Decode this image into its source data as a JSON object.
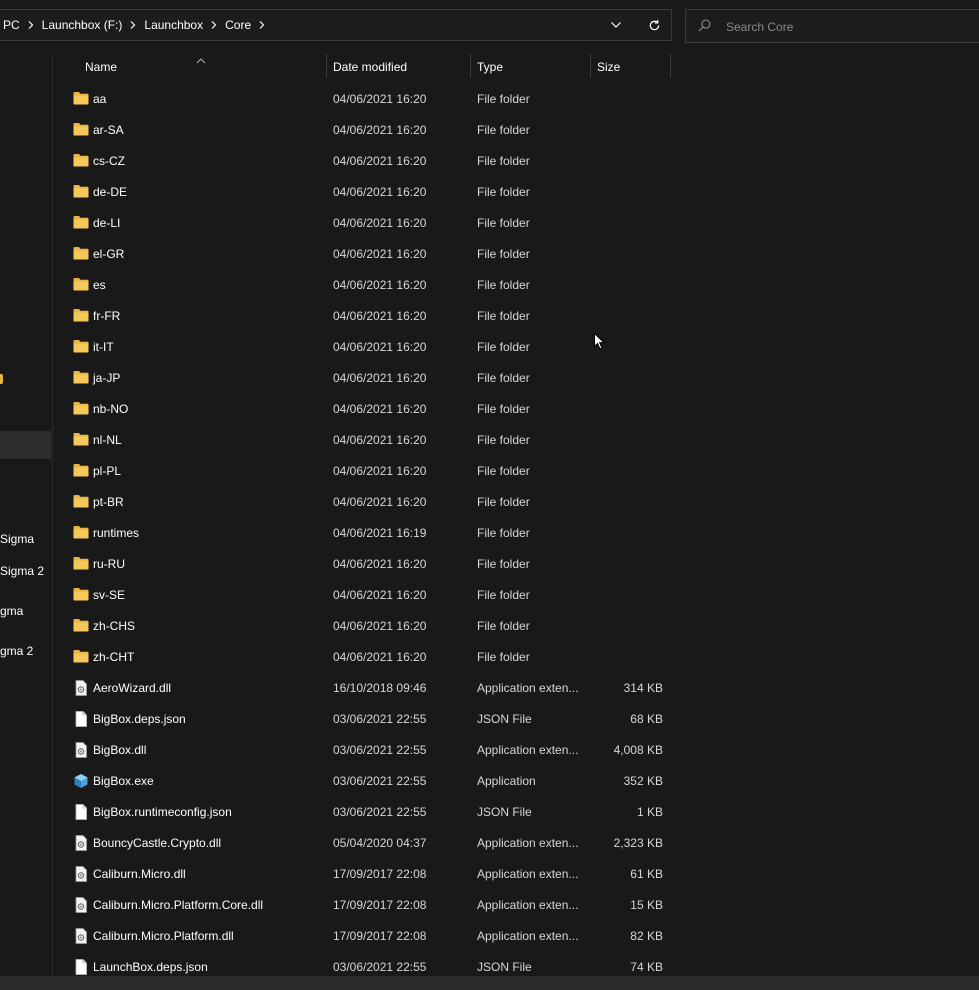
{
  "address": {
    "crumbs": [
      "PC",
      "Launchbox (F:)",
      "Launchbox",
      "Core"
    ]
  },
  "search": {
    "placeholder": "Search Core"
  },
  "nav": {
    "items": [
      "Sigma",
      "Sigma 2",
      "gma",
      "gma 2"
    ]
  },
  "columns": {
    "name": "Name",
    "date": "Date modified",
    "type": "Type",
    "size": "Size"
  },
  "files": [
    {
      "name": "aa",
      "date": "04/06/2021 16:20",
      "type": "File folder",
      "size": "",
      "icon": "folder-icon"
    },
    {
      "name": "ar-SA",
      "date": "04/06/2021 16:20",
      "type": "File folder",
      "size": "",
      "icon": "folder-icon"
    },
    {
      "name": "cs-CZ",
      "date": "04/06/2021 16:20",
      "type": "File folder",
      "size": "",
      "icon": "folder-icon"
    },
    {
      "name": "de-DE",
      "date": "04/06/2021 16:20",
      "type": "File folder",
      "size": "",
      "icon": "folder-icon"
    },
    {
      "name": "de-LI",
      "date": "04/06/2021 16:20",
      "type": "File folder",
      "size": "",
      "icon": "folder-icon"
    },
    {
      "name": "el-GR",
      "date": "04/06/2021 16:20",
      "type": "File folder",
      "size": "",
      "icon": "folder-icon"
    },
    {
      "name": "es",
      "date": "04/06/2021 16:20",
      "type": "File folder",
      "size": "",
      "icon": "folder-icon"
    },
    {
      "name": "fr-FR",
      "date": "04/06/2021 16:20",
      "type": "File folder",
      "size": "",
      "icon": "folder-icon"
    },
    {
      "name": "it-IT",
      "date": "04/06/2021 16:20",
      "type": "File folder",
      "size": "",
      "icon": "folder-icon"
    },
    {
      "name": "ja-JP",
      "date": "04/06/2021 16:20",
      "type": "File folder",
      "size": "",
      "icon": "folder-icon"
    },
    {
      "name": "nb-NO",
      "date": "04/06/2021 16:20",
      "type": "File folder",
      "size": "",
      "icon": "folder-icon"
    },
    {
      "name": "nl-NL",
      "date": "04/06/2021 16:20",
      "type": "File folder",
      "size": "",
      "icon": "folder-icon"
    },
    {
      "name": "pl-PL",
      "date": "04/06/2021 16:20",
      "type": "File folder",
      "size": "",
      "icon": "folder-icon"
    },
    {
      "name": "pt-BR",
      "date": "04/06/2021 16:20",
      "type": "File folder",
      "size": "",
      "icon": "folder-icon"
    },
    {
      "name": "runtimes",
      "date": "04/06/2021 16:19",
      "type": "File folder",
      "size": "",
      "icon": "folder-icon"
    },
    {
      "name": "ru-RU",
      "date": "04/06/2021 16:20",
      "type": "File folder",
      "size": "",
      "icon": "folder-icon"
    },
    {
      "name": "sv-SE",
      "date": "04/06/2021 16:20",
      "type": "File folder",
      "size": "",
      "icon": "folder-icon"
    },
    {
      "name": "zh-CHS",
      "date": "04/06/2021 16:20",
      "type": "File folder",
      "size": "",
      "icon": "folder-icon"
    },
    {
      "name": "zh-CHT",
      "date": "04/06/2021 16:20",
      "type": "File folder",
      "size": "",
      "icon": "folder-icon"
    },
    {
      "name": "AeroWizard.dll",
      "date": "16/10/2018 09:46",
      "type": "Application exten...",
      "size": "314 KB",
      "icon": "dll-file-icon"
    },
    {
      "name": "BigBox.deps.json",
      "date": "03/06/2021 22:55",
      "type": "JSON File",
      "size": "68 KB",
      "icon": "file-icon"
    },
    {
      "name": "BigBox.dll",
      "date": "03/06/2021 22:55",
      "type": "Application exten...",
      "size": "4,008 KB",
      "icon": "dll-file-icon"
    },
    {
      "name": "BigBox.exe",
      "date": "03/06/2021 22:55",
      "type": "Application",
      "size": "352 KB",
      "icon": "exe-app-icon"
    },
    {
      "name": "BigBox.runtimeconfig.json",
      "date": "03/06/2021 22:55",
      "type": "JSON File",
      "size": "1 KB",
      "icon": "file-icon"
    },
    {
      "name": "BouncyCastle.Crypto.dll",
      "date": "05/04/2020 04:37",
      "type": "Application exten...",
      "size": "2,323 KB",
      "icon": "dll-file-icon"
    },
    {
      "name": "Caliburn.Micro.dll",
      "date": "17/09/2017 22:08",
      "type": "Application exten...",
      "size": "61 KB",
      "icon": "dll-file-icon"
    },
    {
      "name": "Caliburn.Micro.Platform.Core.dll",
      "date": "17/09/2017 22:08",
      "type": "Application exten...",
      "size": "15 KB",
      "icon": "dll-file-icon"
    },
    {
      "name": "Caliburn.Micro.Platform.dll",
      "date": "17/09/2017 22:08",
      "type": "Application exten...",
      "size": "82 KB",
      "icon": "dll-file-icon"
    },
    {
      "name": "LaunchBox.deps.json",
      "date": "03/06/2021 22:55",
      "type": "JSON File",
      "size": "74 KB",
      "icon": "file-icon"
    }
  ],
  "colors": {
    "background": "#191919",
    "folder": "#e8b448",
    "exe": "#4ea3d9"
  }
}
